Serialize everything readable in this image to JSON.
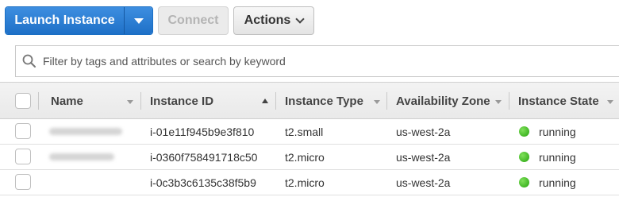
{
  "toolbar": {
    "launch_label": "Launch Instance",
    "connect_label": "Connect",
    "actions_label": "Actions"
  },
  "search": {
    "placeholder": "Filter by tags and attributes or search by keyword"
  },
  "table": {
    "columns": [
      "Name",
      "Instance ID",
      "Instance Type",
      "Availability Zone",
      "Instance State"
    ],
    "rows": [
      {
        "instance_id": "i-01e11f945b9e3f810",
        "type": "t2.small",
        "zone": "us-west-2a",
        "state": "running"
      },
      {
        "instance_id": "i-0360f758491718c50",
        "type": "t2.micro",
        "zone": "us-west-2a",
        "state": "running"
      },
      {
        "instance_id": "i-0c3b3c6135c38f5b9",
        "type": "t2.micro",
        "zone": "us-west-2a",
        "state": "running"
      }
    ]
  },
  "colors": {
    "primary_button": "#1e70c7",
    "running_status": "#2bb014"
  }
}
